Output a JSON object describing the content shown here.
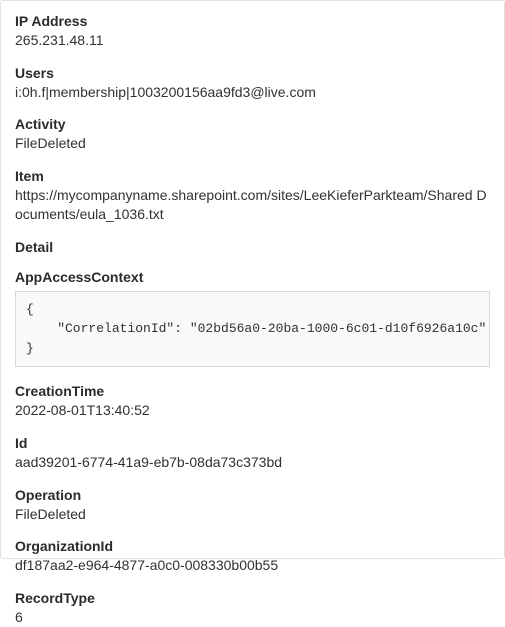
{
  "fields": {
    "ip_address": {
      "label": "IP Address",
      "value": "265.231.48.11"
    },
    "users": {
      "label": "Users",
      "value": "i:0h.f|membership|1003200156aa9fd3@live.com"
    },
    "activity": {
      "label": "Activity",
      "value": "FileDeleted"
    },
    "item": {
      "label": "Item",
      "value": "https://mycompanyname.sharepoint.com/sites/LeeKieferParkteam/Shared Documents/eula_1036.txt"
    }
  },
  "detail": {
    "header": "Detail",
    "app_access_context": {
      "label": "AppAccessContext",
      "code": "{\n    \"CorrelationId\": \"02bd56a0-20ba-1000-6c01-d10f6926a10c\"\n}"
    },
    "creation_time": {
      "label": "CreationTime",
      "value": "2022-08-01T13:40:52"
    },
    "id": {
      "label": "Id",
      "value": "aad39201-6774-41a9-eb7b-08da73c373bd"
    },
    "operation": {
      "label": "Operation",
      "value": "FileDeleted"
    },
    "organization_id": {
      "label": "OrganizationId",
      "value": "df187aa2-e964-4877-a0c0-008330b00b55"
    },
    "record_type": {
      "label": "RecordType",
      "value": "6"
    }
  }
}
